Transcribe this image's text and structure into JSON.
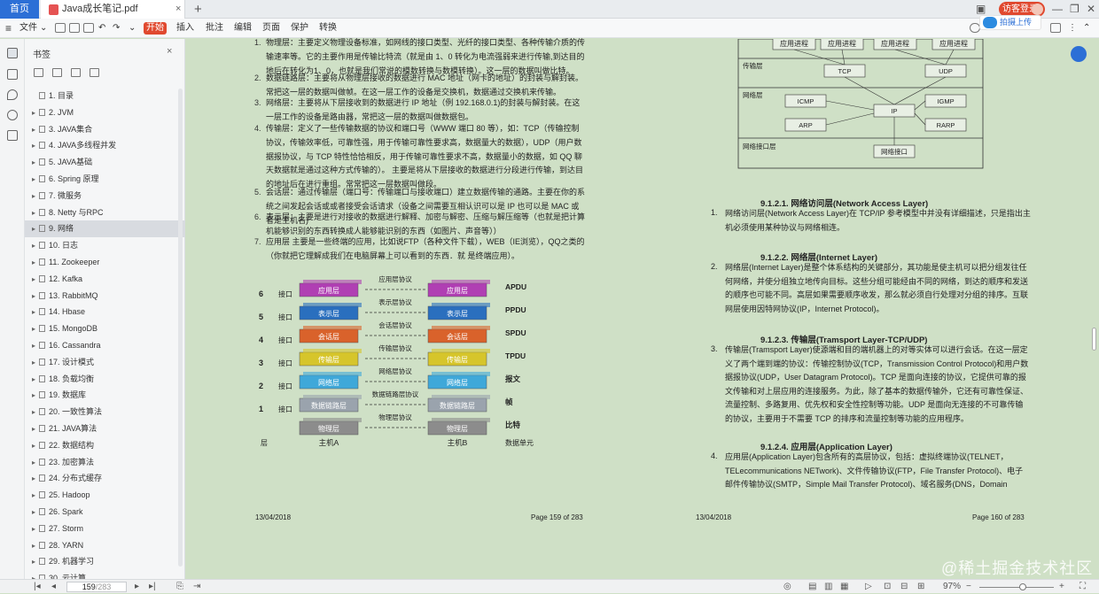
{
  "tabs": {
    "home": "首页",
    "doc": "Java成长笔记.pdf",
    "close": "×",
    "new": "+"
  },
  "window": {
    "login": "访客登录",
    "minimize": "—",
    "restore": "❐",
    "close": "✕",
    "panel": "▣"
  },
  "toolbar": {
    "file": "文件",
    "dropdown": "⌄",
    "start": "开始",
    "insert": "插入",
    "annotate": "批注",
    "edit": "编辑",
    "page": "页面",
    "protect": "保护",
    "convert": "转换",
    "cloud_upload": "拍摄上传"
  },
  "sidebar": {
    "title": "书签",
    "close": "×",
    "items": [
      {
        "arrow": "",
        "label": "1. 目录"
      },
      {
        "arrow": "▸",
        "label": "2. JVM"
      },
      {
        "arrow": "▸",
        "label": "3. JAVA集合"
      },
      {
        "arrow": "▸",
        "label": "4. JAVA多线程并发"
      },
      {
        "arrow": "▸",
        "label": "5. JAVA基础"
      },
      {
        "arrow": "▸",
        "label": "6. Spring 原理"
      },
      {
        "arrow": "▸",
        "label": "7.    微服务"
      },
      {
        "arrow": "▸",
        "label": "8. Netty 与RPC"
      },
      {
        "arrow": "▸",
        "label": "9. 网络"
      },
      {
        "arrow": "▸",
        "label": "10. 日志"
      },
      {
        "arrow": "▸",
        "label": "11. Zookeeper"
      },
      {
        "arrow": "▸",
        "label": "12. Kafka"
      },
      {
        "arrow": "▸",
        "label": "13. RabbitMQ"
      },
      {
        "arrow": "▸",
        "label": "14. Hbase"
      },
      {
        "arrow": "▸",
        "label": "15. MongoDB"
      },
      {
        "arrow": "▸",
        "label": "16. Cassandra"
      },
      {
        "arrow": "▸",
        "label": "17. 设计模式"
      },
      {
        "arrow": "▸",
        "label": "18. 负载均衡"
      },
      {
        "arrow": "▸",
        "label": "19. 数据库"
      },
      {
        "arrow": "▸",
        "label": "20. 一致性算法"
      },
      {
        "arrow": "▸",
        "label": "21. JAVA算法"
      },
      {
        "arrow": "▸",
        "label": "22. 数据结构"
      },
      {
        "arrow": "▸",
        "label": "23. 加密算法"
      },
      {
        "arrow": "▸",
        "label": "24. 分布式缓存"
      },
      {
        "arrow": "▸",
        "label": "25. Hadoop"
      },
      {
        "arrow": "▸",
        "label": "26. Spark"
      },
      {
        "arrow": "▸",
        "label": "27. Storm"
      },
      {
        "arrow": "▸",
        "label": "28. YARN"
      },
      {
        "arrow": "▸",
        "label": "29. 机器学习"
      },
      {
        "arrow": "▸",
        "label": "30. 云计算"
      }
    ],
    "selected_index": 8
  },
  "bottom": {
    "first": "|◂",
    "prev": "◂",
    "page_current": "159",
    "page_total": "/283",
    "next": "▸",
    "last": "▸|",
    "zoom": "97%",
    "fullscreen": "⛶"
  },
  "left_page": {
    "paragraphs": [
      {
        "n": "1.",
        "text": "物理层：主要定义物理设备标准，如网线的接口类型、光纤的接口类型、各种传输介质的传输速率等。它的主要作用是传输比特流（就是由 1、0 转化为电流强弱来进行传输,到达目的地后在转化为1、0，也就是我们常说的模数转换与数模转换）。这一层的数据叫做比特。"
      },
      {
        "n": "2.",
        "text": "数据链路层：主要将从物理层接收的数据进行 MAC 地址（网卡的地址）的封装与解封装。常把这一层的数据叫做帧。在这一层工作的设备是交换机，数据通过交换机来传输。"
      },
      {
        "n": "3.",
        "text": "网络层：主要将从下层接收到的数据进行 IP 地址（例 192.168.0.1)的封装与解封装。在这一层工作的设备是路由器，常把这一层的数据叫做数据包。"
      },
      {
        "n": "4.",
        "text": "传输层：定义了一些传输数据的协议和端口号（WWW 端口 80 等），如：TCP（传输控制协议，传输效率低，可靠性强，用于传输可靠性要求高，数据量大的数据），UDP（用户数据报协议，与 TCP 特性恰恰相反，用于传输可靠性要求不高，数据量小的数据，如 QQ 聊天数据就是通过这种方式传输的）。 主要是将从下层接收的数据进行分段进行传输，到达目的地址后在进行重组。常常把这一层数据叫做段。"
      },
      {
        "n": "5.",
        "text": "会话层：通过传输层（端口号：传输端口与接收端口）建立数据传输的通路。主要在你的系统之间发起会话或或者接受会话请求（设备之间需要互相认识可以是 IP 也可以是 MAC 或者是主机名)"
      },
      {
        "n": "6.",
        "text": "表示层：主要是进行对接收的数据进行解释、加密与解密、压缩与解压缩等（也就是把计算机能够识别的东西转换成人能够能识别的东西（如图片、声音等））"
      },
      {
        "n": "7.",
        "text": "应用层 主要是一些终端的应用，比如说FTP（各种文件下载），WEB（IE浏览），QQ之类的（你就把它理解成我们在电脑屏幕上可以看到的东西．就 是终端应用）。"
      }
    ],
    "footer_date": "13/04/2018",
    "footer_page": "Page 159 of 283"
  },
  "osi_diagram": {
    "layers": [
      {
        "num": "6",
        "name": "应用层",
        "protocol": "应用层协议",
        "pdu": "APDU",
        "color": "#b03fb3"
      },
      {
        "num": "5",
        "name": "表示层",
        "protocol": "表示层协议",
        "pdu": "PPDU",
        "color": "#2a6fbe"
      },
      {
        "num": "4",
        "name": "会话层",
        "protocol": "会话层协议",
        "pdu": "SPDU",
        "color": "#d9622b"
      },
      {
        "num": "3",
        "name": "传输层",
        "protocol": "传输层协议",
        "pdu": "TPDU",
        "color": "#d6c52b"
      },
      {
        "num": "2",
        "name": "网络层",
        "protocol": "网络层协议",
        "pdu": "报文",
        "color": "#3fa8d9"
      },
      {
        "num": "1",
        "name": "数据链路层",
        "protocol": "数据链路层协议",
        "pdu": "帧",
        "color": "#9aa3ad"
      },
      {
        "num": "",
        "name": "物理层",
        "protocol": "物理层协议",
        "pdu": "比特",
        "color": "#8c8c8c"
      }
    ],
    "interface": "接口",
    "host_a": "主机A",
    "host_b": "主机B",
    "layer_label": "层",
    "data_unit": "数据单元"
  },
  "tcpip_diagram": {
    "app": [
      "应用进程",
      "应用进程",
      "应用进程",
      "应用进程"
    ],
    "layer_labels": [
      "传输层",
      "网络层",
      "网络接口层"
    ],
    "boxes": {
      "tcp": "TCP",
      "udp": "UDP",
      "icmp": "ICMP",
      "igmp": "IGMP",
      "ip": "IP",
      "arp": "ARP",
      "rarp": "RARP",
      "iface": "网络接口"
    }
  },
  "right_page": {
    "sections": [
      {
        "head": "9.1.2.1.    网络访问层(Network Access Layer)",
        "n": "1.",
        "text": "网络访问层(Network Access Layer)在 TCP/IP 参考模型中并没有详细描述，只是指出主机必须使用某种协议与网络相连。"
      },
      {
        "head": "9.1.2.2.    网络层(Internet Layer)",
        "n": "2.",
        "text": "网络层(Internet Layer)是整个体系结构的关键部分，其功能是使主机可以把分组发往任何网络，并使分组独立地传向目标。这些分组可能经由不同的网络，到达的顺序和发送的顺序也可能不同。高层如果需要顺序收发，那么就必须自行处理对分组的排序。互联网层使用因特网协议(IP，Internet Protocol)。"
      },
      {
        "head": "9.1.2.3.    传输层(Tramsport Layer-TCP/UDP)",
        "n": "3.",
        "text": "传输层(Tramsport Layer)使源端和目的端机器上的对等实体可以进行会话。在这一层定义了两个端到端的协议：传输控制协议(TCP，Transmission Control Protocol)和用户数据报协议(UDP，User Datagram Protocol)。TCP 是面向连接的协议，它提供可靠的报文传输和对上层应用的连接服务。为此，除了基本的数据传输外，它还有可靠性保证、流量控制、多路复用、优先权和安全性控制等功能。UDP 是面向无连接的不可靠传输的协议，主要用于不需要 TCP 的排序和流量控制等功能的应用程序。"
      },
      {
        "head": "9.1.2.4.    应用层(Application Layer)",
        "n": "4.",
        "text": "应用层(Application Layer)包含所有的高层协议，包括：虚拟终端协议(TELNET，TELecommunications NETwork)、文件传输协议(FTP，File Transfer Protocol)、电子邮件传输协议(SMTP，Simple Mail Transfer Protocol)、域名服务(DNS，Domain Name"
      }
    ],
    "footer_date": "13/04/2018",
    "footer_page": "Page 160 of 283"
  },
  "watermark": "@稀土掘金技术社区"
}
